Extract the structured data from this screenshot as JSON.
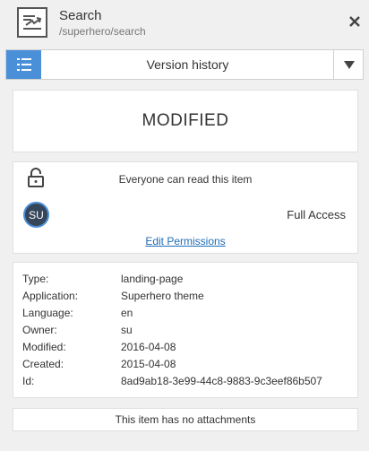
{
  "header": {
    "title": "Search",
    "path": "/superhero/search",
    "app_icon": "page-type-icon",
    "close_icon": "close-icon"
  },
  "toolbar": {
    "list_icon": "list-icon",
    "version_history_label": "Version history",
    "dropdown_icon": "triangle-down-icon"
  },
  "status": {
    "label": "MODIFIED"
  },
  "permissions": {
    "lock_icon": "unlock-icon",
    "read_text": "Everyone can read this item",
    "avatar_initials": "SU",
    "access_level": "Full Access",
    "edit_link": "Edit Permissions"
  },
  "metadata": {
    "rows": [
      {
        "key": "Type:",
        "value": "landing-page"
      },
      {
        "key": "Application:",
        "value": "Superhero theme"
      },
      {
        "key": "Language:",
        "value": "en"
      },
      {
        "key": "Owner:",
        "value": "su"
      },
      {
        "key": "Modified:",
        "value": "2016-04-08"
      },
      {
        "key": "Created:",
        "value": "2015-04-08"
      },
      {
        "key": "Id:",
        "value": "8ad9ab18-3e99-44c8-9883-9c3eef86b507"
      }
    ]
  },
  "attachments": {
    "text": "This item has no attachments"
  },
  "colors": {
    "accent": "#4a90d9",
    "link": "#1f6bb5",
    "avatar_bg": "#36465a",
    "background": "#f0f0f0"
  }
}
